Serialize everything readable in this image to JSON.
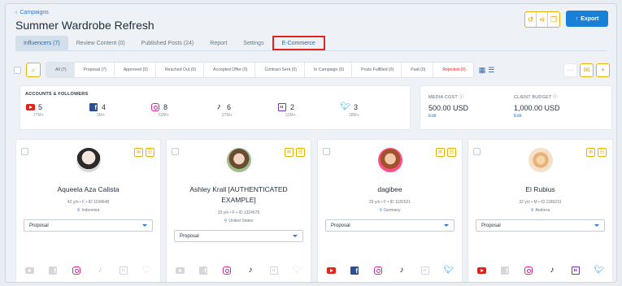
{
  "header": {
    "breadcrumb": "Campaigns",
    "title": "Summer Wardrobe Refresh",
    "export_label": "Export"
  },
  "tabs": [
    {
      "label": "Influencers (7)",
      "active": true
    },
    {
      "label": "Review Content (0)"
    },
    {
      "label": "Published Posts (24)"
    },
    {
      "label": "Report"
    },
    {
      "label": "Settings"
    },
    {
      "label": "E-Commerce",
      "highlighted": true
    }
  ],
  "filters": [
    {
      "label": "All (7)"
    },
    {
      "label": "Proposal (7)"
    },
    {
      "label": "Approved (0)"
    },
    {
      "label": "Reached Out (0)"
    },
    {
      "label": "Accepted Offer (0)"
    },
    {
      "label": "Contract Sent (0)"
    },
    {
      "label": "In Campaign (0)"
    },
    {
      "label": "Posts Fulfilled (0)"
    },
    {
      "label": "Paid (0)"
    },
    {
      "label": "Rejected (0)"
    }
  ],
  "accounts": {
    "label": "ACCOUNTS & FOLLOWERS",
    "platforms": [
      {
        "icon": "youtube-icon",
        "count": "5",
        "followers": "77M+"
      },
      {
        "icon": "facebook-icon",
        "count": "4",
        "followers": "3M+"
      },
      {
        "icon": "instagram-icon",
        "count": "8",
        "followers": "52M+"
      },
      {
        "icon": "tiktok-icon",
        "count": "6",
        "followers": "27M+"
      },
      {
        "icon": "twitch-icon",
        "count": "2",
        "followers": "31M+"
      },
      {
        "icon": "twitter-icon",
        "count": "3",
        "followers": "28M+"
      }
    ]
  },
  "media_cost": {
    "label": "MEDIA COST",
    "value": "500.00 USD",
    "edit": "Edit"
  },
  "client_budget": {
    "label": "CLIENT BUDGET",
    "value": "1,000.00 USD",
    "edit": "Edit"
  },
  "influencers": [
    {
      "name": "Aqueela Aza Calista",
      "meta": "42 y/o • F • ID 1194648",
      "location": "Indonesia",
      "status": "Proposal",
      "socials": [
        false,
        false,
        true,
        false,
        false,
        false
      ]
    },
    {
      "name": "Ashley Krall [AUTHENTICATED EXAMPLE]",
      "meta": "33 y/o • F • ID 1324576",
      "location": "United States",
      "status": "Proposal",
      "socials": [
        false,
        false,
        true,
        true,
        false,
        false
      ]
    },
    {
      "name": "dagibee",
      "meta": "29 y/o • F • ID 1181521",
      "location": "Germany",
      "status": "Proposal",
      "socials": [
        true,
        true,
        true,
        true,
        false,
        true
      ]
    },
    {
      "name": "El Rubius",
      "meta": "32 y/o • M • ID 1189231",
      "location": "Andorra",
      "status": "Proposal",
      "socials": [
        true,
        false,
        true,
        true,
        true,
        true
      ]
    }
  ],
  "colors": {
    "accent": "#1a7fd6",
    "warning": "#e6b400",
    "highlight": "#e02424"
  }
}
